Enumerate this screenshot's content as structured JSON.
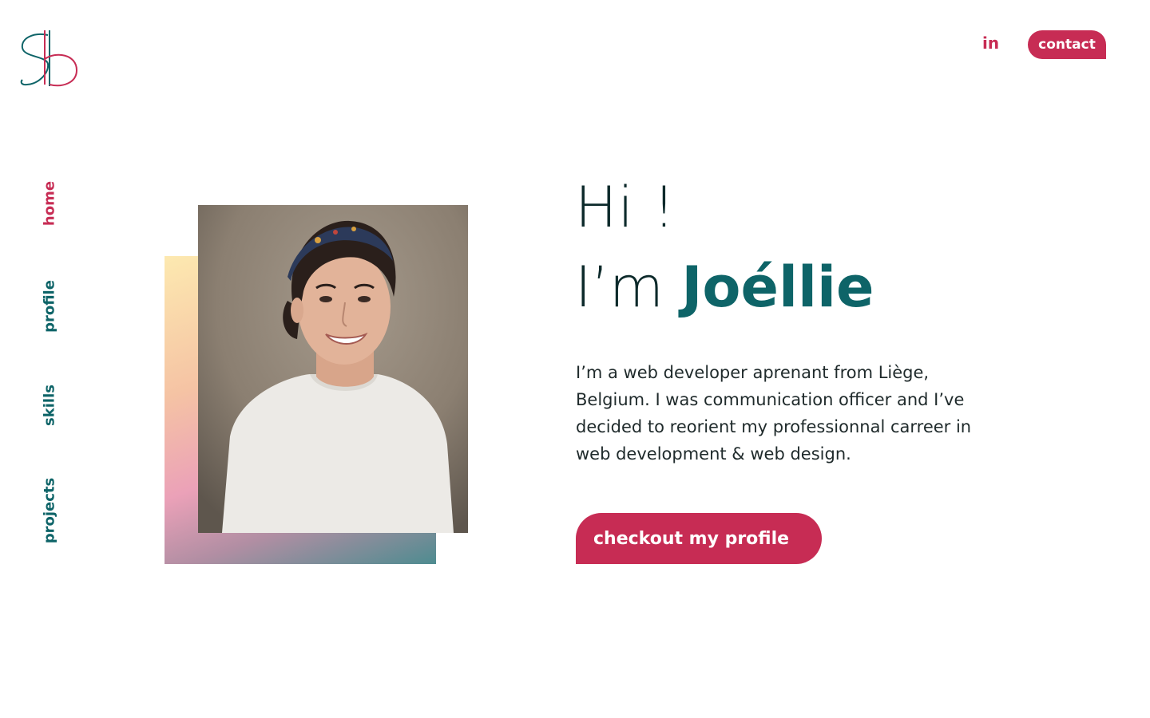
{
  "header": {
    "logo_icon": "sb-monogram-logo",
    "linkedin_label": "in",
    "contact_label": "contact"
  },
  "nav": {
    "items": [
      {
        "label": "home",
        "active": true
      },
      {
        "label": "profile",
        "active": false
      },
      {
        "label": "skills",
        "active": false
      },
      {
        "label": "projects",
        "active": false
      }
    ]
  },
  "hero": {
    "greeting": "Hi !",
    "intro_prefix": "I’m ",
    "name": "Joéllie",
    "bio": "I’m a web developer aprenant from Liège, Belgium. I was communication officer and I’ve decided to reorient my professionnal carreer in web development & web design.",
    "cta_label": "checkout my profile",
    "photo_icon": "portrait-photo"
  },
  "colors": {
    "accent": "#c72c54",
    "primary": "#0e6468",
    "text": "#0d2a2b"
  }
}
